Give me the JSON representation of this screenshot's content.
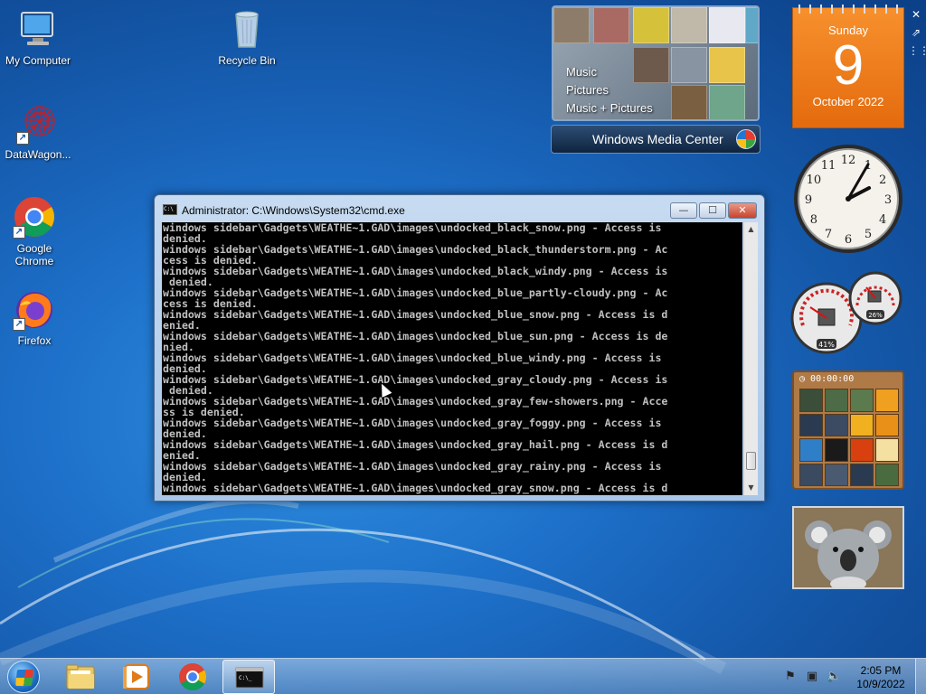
{
  "desktop_icons": [
    {
      "label": "My Computer",
      "icon": "computer-icon"
    },
    {
      "label": "Recycle Bin",
      "icon": "recycle-bin-icon"
    },
    {
      "label": "DataWagon...",
      "icon": "datawagon-icon"
    },
    {
      "label": "Google Chrome",
      "icon": "chrome-icon"
    },
    {
      "label": "Firefox",
      "icon": "firefox-icon"
    }
  ],
  "media_center": {
    "menu": [
      "Music",
      "Pictures",
      "Music + Pictures"
    ],
    "brand": "Windows Media Center"
  },
  "calendar": {
    "weekday": "Sunday",
    "day": "9",
    "month_year": "October 2022"
  },
  "clock": {
    "hour": 2,
    "minute": 5
  },
  "cpu_meter": {
    "cpu_percent": "41%",
    "memory_percent": "26%"
  },
  "puzzle": {
    "timer": "00:00:00"
  },
  "cmd_window": {
    "title": "Administrator: C:\\Windows\\System32\\cmd.exe",
    "icon_text": "C:\\",
    "minimize": "—",
    "maximize": "☐",
    "close": "✕",
    "lines": [
      "windows sidebar\\Gadgets\\WEATHE~1.GAD\\images\\undocked_black_snow.png - Access is",
      "denied.",
      "windows sidebar\\Gadgets\\WEATHE~1.GAD\\images\\undocked_black_thunderstorm.png - Ac",
      "cess is denied.",
      "windows sidebar\\Gadgets\\WEATHE~1.GAD\\images\\undocked_black_windy.png - Access is",
      " denied.",
      "windows sidebar\\Gadgets\\WEATHE~1.GAD\\images\\undocked_blue_partly-cloudy.png - Ac",
      "cess is denied.",
      "windows sidebar\\Gadgets\\WEATHE~1.GAD\\images\\undocked_blue_snow.png - Access is d",
      "enied.",
      "windows sidebar\\Gadgets\\WEATHE~1.GAD\\images\\undocked_blue_sun.png - Access is de",
      "nied.",
      "windows sidebar\\Gadgets\\WEATHE~1.GAD\\images\\undocked_blue_windy.png - Access is",
      "denied.",
      "windows sidebar\\Gadgets\\WEATHE~1.GAD\\images\\undocked_gray_cloudy.png - Access is",
      " denied.",
      "windows sidebar\\Gadgets\\WEATHE~1.GAD\\images\\undocked_gray_few-showers.png - Acce",
      "ss is denied.",
      "windows sidebar\\Gadgets\\WEATHE~1.GAD\\images\\undocked_gray_foggy.png - Access is",
      "denied.",
      "windows sidebar\\Gadgets\\WEATHE~1.GAD\\images\\undocked_gray_hail.png - Access is d",
      "enied.",
      "windows sidebar\\Gadgets\\WEATHE~1.GAD\\images\\undocked_gray_rainy.png - Access is",
      "denied.",
      "windows sidebar\\Gadgets\\WEATHE~1.GAD\\images\\undocked_gray_snow.png - Access is d"
    ]
  },
  "taskbar": {
    "pinned": [
      {
        "name": "explorer",
        "icon": "folder-icon"
      },
      {
        "name": "media-player",
        "icon": "media-player-icon"
      },
      {
        "name": "chrome",
        "icon": "chrome-icon"
      },
      {
        "name": "cmd",
        "icon": "cmd-icon",
        "active": true
      }
    ],
    "time": "2:05 PM",
    "date": "10/9/2022"
  },
  "colors": {
    "desktop": "#1d6fc8",
    "calendar": "#f07f22",
    "console_bg": "#000000",
    "console_fg": "#c0c0c0"
  }
}
